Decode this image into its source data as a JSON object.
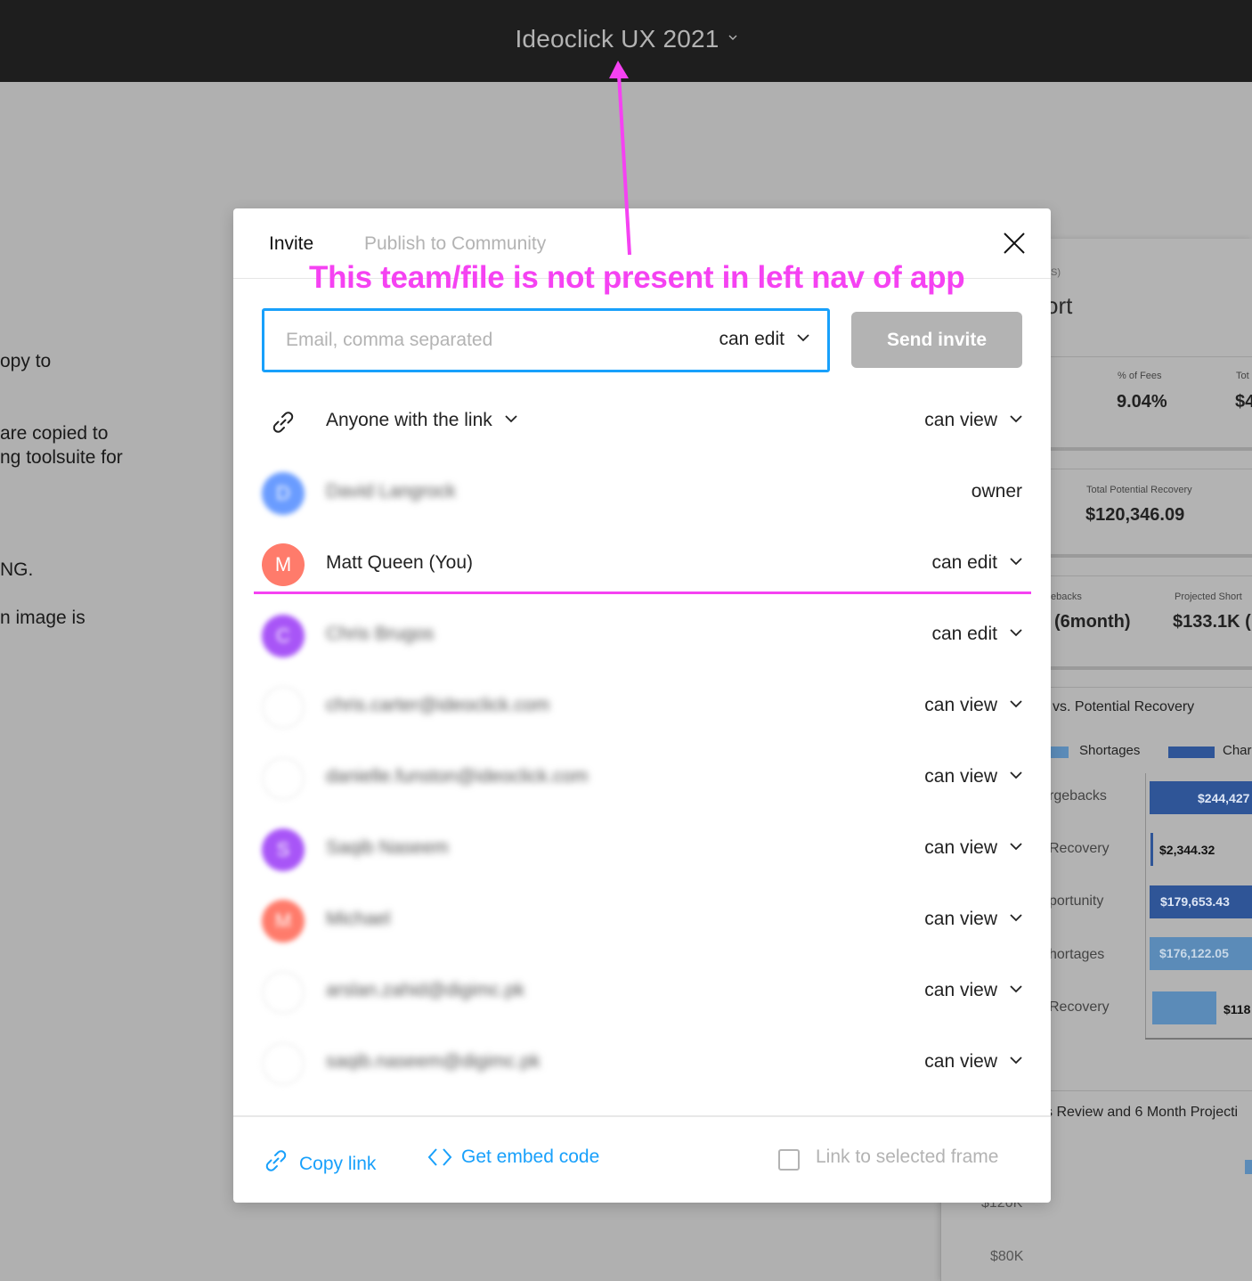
{
  "topbar": {
    "title": "Ideoclick UX 2021"
  },
  "background_left": {
    "lines": [
      "opy to",
      " are copied to",
      "ng toolsuite for",
      "NG.",
      "n image is"
    ]
  },
  "background_right": {
    "subtitle": "S)",
    "title": "ort",
    "kpis": [
      {
        "label": "% of Fees",
        "value": "9.04%"
      },
      {
        "label": "Tot",
        "value": "$4"
      },
      {
        "label": "Total Potential Recovery",
        "value": "$120,346.09"
      },
      {
        "label": "ebacks",
        "value": "(6month)"
      },
      {
        "label": "Projected Short",
        "value": "$133.1K ("
      }
    ],
    "chart1": {
      "title": "vs. Potential Recovery",
      "legend": [
        "Shortages",
        "Char"
      ],
      "categories": [
        "rgebacks",
        "Recovery",
        "portunity",
        "hortages",
        "Recovery"
      ],
      "bar_labels": [
        "$244,427",
        "$2,344.32",
        "$179,653.43",
        "$176,122.05",
        "$118"
      ]
    },
    "chart2": {
      "title": "s Review and 6 Month Projecti",
      "y_ticks": [
        "$120K",
        "$80K"
      ]
    },
    "colors": {
      "dark_blue": "#2f5597",
      "light_blue": "#5b8bb8"
    }
  },
  "modal": {
    "tabs": [
      {
        "label": "Invite",
        "active": true
      },
      {
        "label": "Publish to Community",
        "active": false
      }
    ],
    "invite": {
      "placeholder": "Email, comma separated",
      "value": "",
      "permission": "can edit",
      "send_label": "Send invite"
    },
    "link_access": {
      "label": "Anyone with the link",
      "role": "can view"
    },
    "members": [
      {
        "initial": "D",
        "name": "David Langrock",
        "role": "owner",
        "color": "#6a9cff",
        "blurred": true,
        "has_dropdown": false,
        "empty_avatar": false
      },
      {
        "initial": "M",
        "name": "Matt Queen (You)",
        "role": "can edit",
        "color": "#ff7b6b",
        "blurred": false,
        "has_dropdown": true,
        "empty_avatar": false
      },
      {
        "initial": "C",
        "name": "Chris Brugos",
        "role": "can edit",
        "color": "#a855f7",
        "blurred": true,
        "has_dropdown": true,
        "empty_avatar": false
      },
      {
        "initial": "",
        "name": "chris.carter@ideoclick.com",
        "role": "can view",
        "color": "#ffffff",
        "blurred": true,
        "has_dropdown": true,
        "empty_avatar": true
      },
      {
        "initial": "",
        "name": "danielle.funston@ideoclick.com",
        "role": "can view",
        "color": "#ffffff",
        "blurred": true,
        "has_dropdown": true,
        "empty_avatar": true
      },
      {
        "initial": "S",
        "name": "Saqib Naseem",
        "role": "can view",
        "color": "#a855f7",
        "blurred": true,
        "has_dropdown": true,
        "empty_avatar": false
      },
      {
        "initial": "M",
        "name": "Michael",
        "role": "can view",
        "color": "#ff7b6b",
        "blurred": true,
        "has_dropdown": true,
        "empty_avatar": false
      },
      {
        "initial": "",
        "name": "arslan.zahid@digimc.pk",
        "role": "can view",
        "color": "#ffffff",
        "blurred": true,
        "has_dropdown": true,
        "empty_avatar": true
      },
      {
        "initial": "",
        "name": "saqib.naseem@digimc.pk",
        "role": "can view",
        "color": "#ffffff",
        "blurred": true,
        "has_dropdown": true,
        "empty_avatar": true
      }
    ],
    "footer": {
      "copy_link": "Copy link",
      "embed_code": "Get embed code",
      "frame_label": "Link to selected frame",
      "frame_checked": false
    }
  },
  "annotation": {
    "text": "This team/file is not present in left nav of app",
    "color": "#f542f2"
  },
  "colors": {
    "accent": "#18a0fb",
    "disabled": "#b3b3b3"
  }
}
